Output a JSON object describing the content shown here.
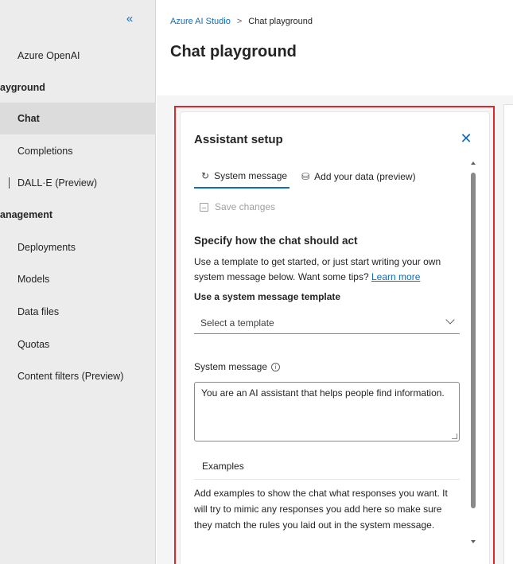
{
  "sidebar": {
    "collapse_icon": "double-chevron-left",
    "collapse_glyph": "«",
    "items": [
      {
        "label": "Azure OpenAI",
        "type": "link"
      },
      {
        "label": "ayground",
        "type": "section"
      },
      {
        "label": "Chat",
        "type": "link",
        "active": true
      },
      {
        "label": "Completions",
        "type": "link"
      },
      {
        "label": "DALL·E (Preview)",
        "type": "link"
      },
      {
        "label": "anagement",
        "type": "section"
      },
      {
        "label": "Deployments",
        "type": "link"
      },
      {
        "label": "Models",
        "type": "link"
      },
      {
        "label": "Data files",
        "type": "link"
      },
      {
        "label": "Quotas",
        "type": "link"
      },
      {
        "label": "Content filters (Preview)",
        "type": "link"
      }
    ]
  },
  "breadcrumb": {
    "root": "Azure AI Studio",
    "separator": ">",
    "current": "Chat playground"
  },
  "page_title": "Chat playground",
  "assistant_setup": {
    "title": "Assistant setup",
    "close_icon": "close-icon",
    "close_glyph": "✕",
    "tabs": [
      {
        "label": "System message",
        "icon": "refresh-icon",
        "glyph": "↻",
        "selected": true
      },
      {
        "label": "Add your data (preview)",
        "icon": "database-icon",
        "glyph": "⛁",
        "selected": false
      }
    ],
    "save_label": "Save changes",
    "heading": "Specify how the chat should act",
    "description": "Use a template to get started, or just start writing your own system message below. Want some tips?",
    "learn_more": "Learn more",
    "template_label": "Use a system message template",
    "template_placeholder": "Select a template",
    "system_message_label": "System message",
    "info_glyph": "i",
    "system_message_value": "You are an AI assistant that helps people find information.",
    "examples_label": "Examples",
    "examples_description": "Add examples to show the chat what responses you want. It will try to mimic any responses you add here so make sure they match the rules you laid out in the system message."
  },
  "colors": {
    "accent": "#0f6cbd",
    "highlight_border": "#e0262c",
    "sidebar_bg": "#ececec",
    "active_item_bg": "#dcdcdc"
  }
}
